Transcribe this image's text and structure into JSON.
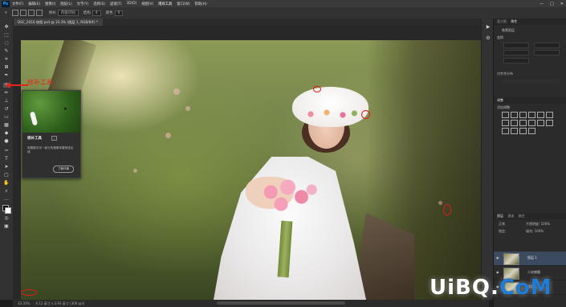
{
  "menu": {
    "logo": "Ps",
    "items": [
      "文件(F)",
      "编辑(E)",
      "图像(I)",
      "图层(L)",
      "文字(Y)",
      "选择(S)",
      "滤镜(T)",
      "3D(D)",
      "视图(V)",
      "增效工具",
      "窗口(W)",
      "帮助(H)"
    ],
    "active_index": 9,
    "win_controls": [
      "—",
      "□",
      "✕"
    ]
  },
  "options": {
    "mode_label": "修补",
    "mode_value": "内容识别",
    "structure_label": "结构",
    "structure_value": "4",
    "color_label": "颜色",
    "color_value": "0"
  },
  "document": {
    "tab_title": "DSC_2016 修图.psd @ 33.3% (图层 1, RGB/8#) *"
  },
  "annotation": {
    "label": "修补工具"
  },
  "tooltip": {
    "title": "修补工具",
    "badge": "J",
    "description": "用图像中另一部分的像素来替换选区域",
    "button": "了解详情"
  },
  "status": {
    "zoom": "33.33%",
    "info": "6.12 英寸 x 3.93 英寸 (300 ppi)"
  },
  "panels": {
    "top_tabs": [
      "直方图",
      "属性"
    ],
    "props_title": "像素图层",
    "transform_title": "变换",
    "align_title": "对齐并分布",
    "adjust_tabs": [
      "调整"
    ],
    "adjust_label": "添加调整",
    "layer_tabs": [
      "图层",
      "通道",
      "路径"
    ],
    "mode": "正常",
    "opacity": "不透明度: 100%",
    "fill": "填充: 100%",
    "lock": "锁定:"
  },
  "layers": [
    {
      "name": "图层 1",
      "selected": true
    },
    {
      "name": "二次修图",
      "selected": false
    },
    {
      "name": "背景层",
      "selected": false
    }
  ],
  "watermark": {
    "text_a": "UiBQ.",
    "text_b": "CoM"
  },
  "accent": "#e3261a"
}
